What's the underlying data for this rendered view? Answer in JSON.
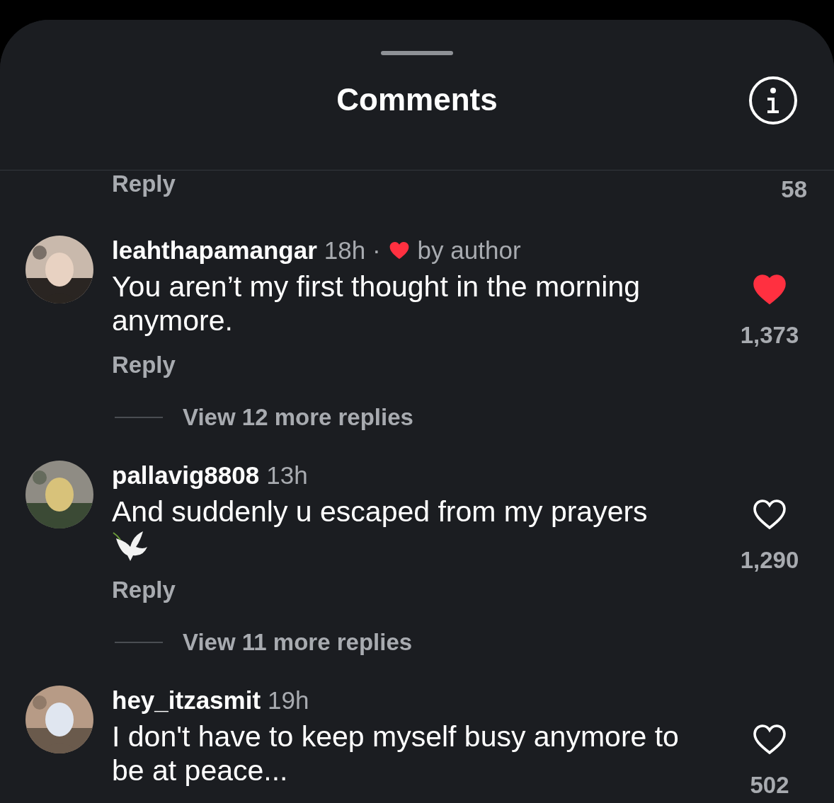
{
  "sheet": {
    "title": "Comments"
  },
  "top_partial": {
    "reply": "Reply",
    "likes": "58"
  },
  "comments": [
    {
      "username": "leahthapamangar",
      "time": "18h",
      "liked_by_author": true,
      "separator": "·",
      "author_label": "by author",
      "text": "You aren’t my first thought in the morning anymore.",
      "dove": false,
      "liked": true,
      "likes": "1,373",
      "reply": "Reply",
      "view_replies": "View 12 more replies"
    },
    {
      "username": "pallavig8808",
      "time": "13h",
      "liked_by_author": false,
      "text": "And suddenly u escaped from my prayers",
      "dove": true,
      "liked": false,
      "likes": "1,290",
      "reply": "Reply",
      "view_replies": "View 11 more replies"
    },
    {
      "username": "hey_itzasmit",
      "time": "19h",
      "liked_by_author": false,
      "text": "I don't have to keep myself busy anymore to be at peace...",
      "dove": false,
      "liked": false,
      "likes": "502"
    }
  ]
}
